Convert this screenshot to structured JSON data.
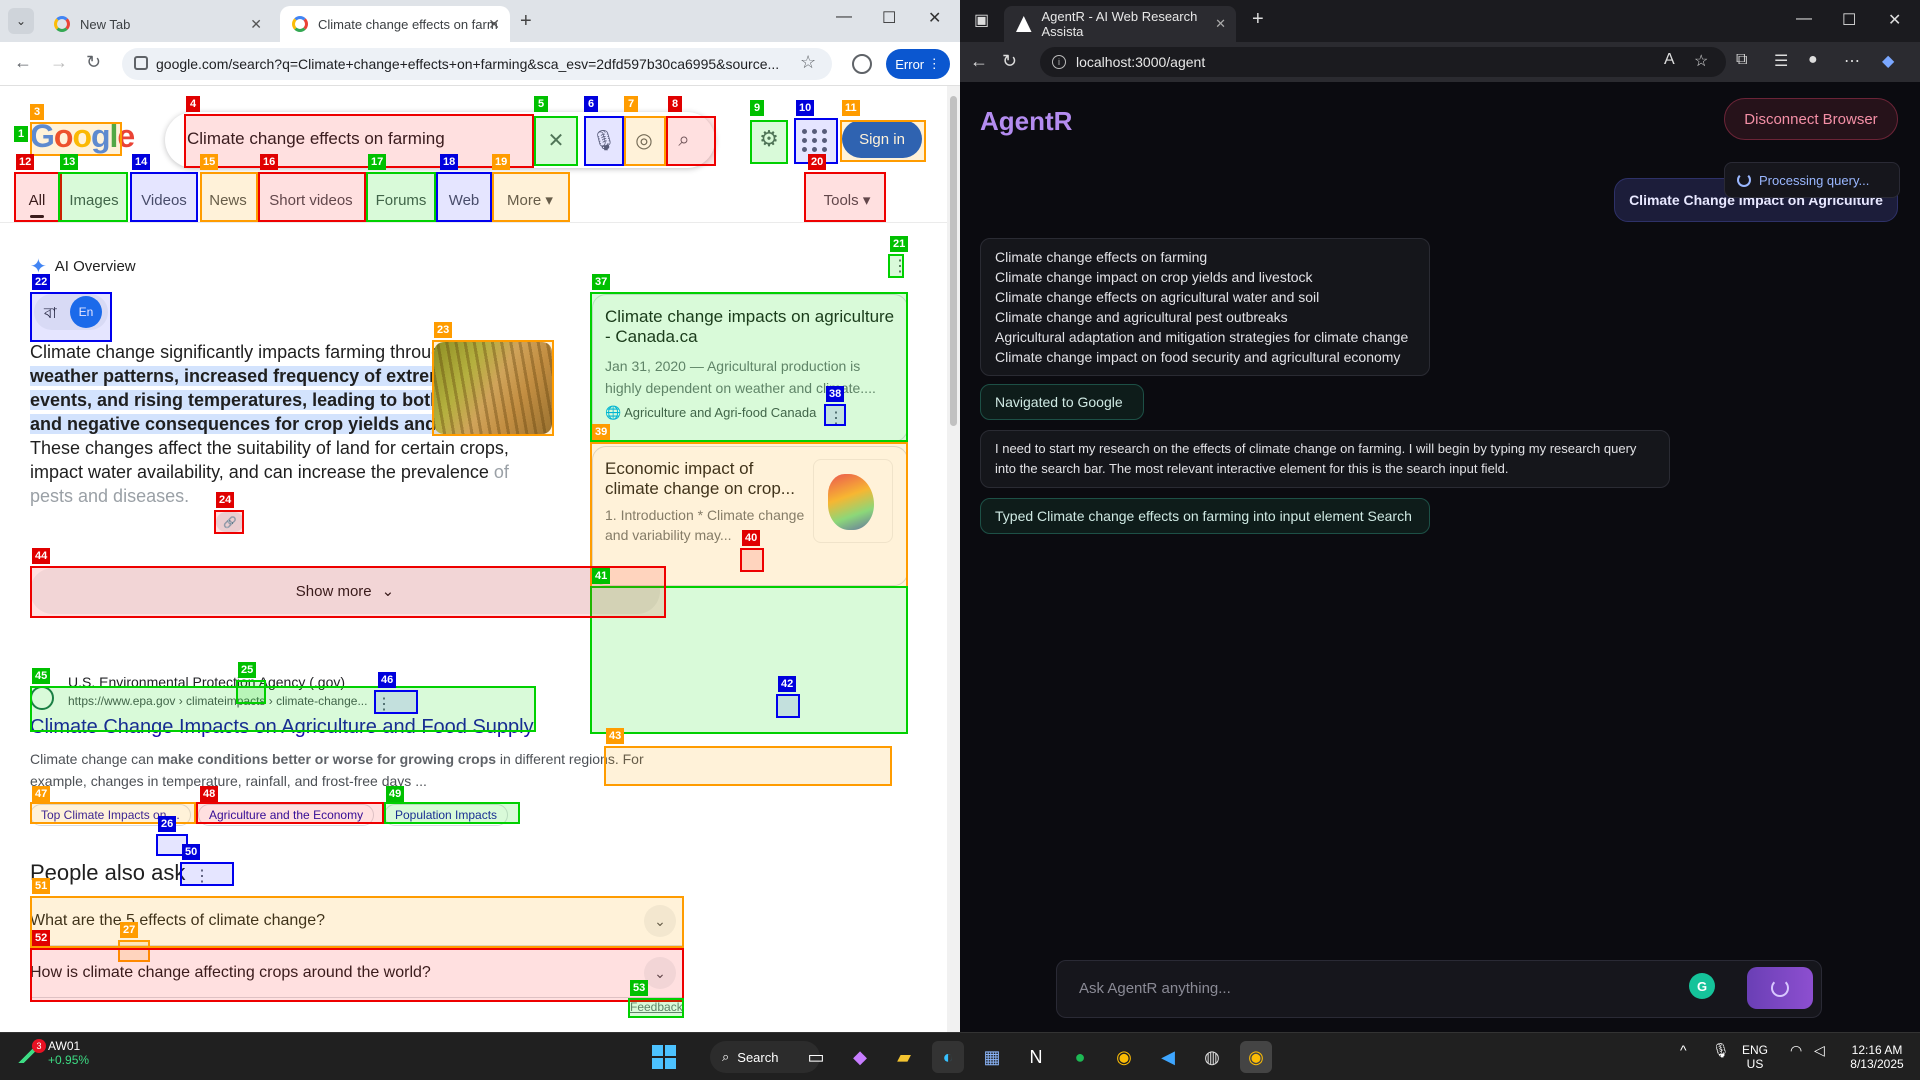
{
  "left_browser": {
    "tabs": [
      {
        "title": "New Tab"
      },
      {
        "title": "Climate change effects on farm"
      }
    ],
    "url": "google.com/search?q=Climate+change+effects+on+farming&sca_esv=2dfd597b30ca6995&source...",
    "error_label": "Error"
  },
  "google": {
    "logo": {
      "G": "G",
      "o1": "o",
      "o2": "o",
      "g": "g",
      "l": "l",
      "e": "e"
    },
    "query": "Climate change effects on farming",
    "sign_in": "Sign in",
    "tabs": [
      "All",
      "Images",
      "Videos",
      "News",
      "Short videos",
      "Forums",
      "Web",
      "More"
    ],
    "tools": "Tools",
    "ai_overview": {
      "heading": "AI Overview",
      "lang_bn": "বা",
      "lang_en": "En",
      "text_intro": "Climate change significantly impacts farming through ",
      "text_highlight": "altered weather patterns, increased frequency of extreme weather events, and rising temperatures, leading to both positive and negative consequences for crop yields and livestock",
      "text_rest": ". These changes affect the suitability of land for certain crops, impact water availability, and can increase the prevalence ",
      "text_fade": "of pests and diseases.",
      "show_more": "Show more"
    },
    "source_cards": [
      {
        "title": "Climate change impacts on agriculture - Canada.ca",
        "desc": "Jan 31, 2020 — Agricultural production is highly dependent on weather and climate....",
        "source": "Agriculture and Agri-food Canada"
      },
      {
        "title": "Economic impact of climate change on crop...",
        "desc": "1. Introduction * Climate change and variability may..."
      }
    ],
    "result": {
      "site": "U.S. Environmental Protection Agency (.gov)",
      "url": "https://www.epa.gov › climateimpacts › climate-change...",
      "title": "Climate Change Impacts on Agriculture and Food Supply",
      "snippet_a": "Climate change can ",
      "snippet_b": "make conditions better or worse for growing crops",
      "snippet_c": " in different regions. For example, changes in temperature, rainfall, and frost-free days ...",
      "sitelinks": [
        "Top Climate Impacts on ...",
        "Agriculture and the Economy",
        "Population Impacts"
      ]
    },
    "people_also_ask": {
      "heading": "People also ask",
      "questions": [
        "What are the 5 effects of climate change?",
        "How is climate change affecting crops around the world?"
      ]
    },
    "feedback": "Feedback"
  },
  "overlay_tags": [
    "1",
    "3",
    "4",
    "5",
    "6",
    "7",
    "8",
    "9",
    "10",
    "11",
    "12",
    "13",
    "14",
    "15",
    "16",
    "17",
    "18",
    "19",
    "20",
    "21",
    "22",
    "23",
    "24",
    "25",
    "26",
    "27",
    "37",
    "38",
    "39",
    "40",
    "41",
    "42",
    "43",
    "44",
    "45",
    "46",
    "47",
    "48",
    "49",
    "50",
    "51",
    "52",
    "53"
  ],
  "right_browser": {
    "tab_title": "AgentR - AI Web Research Assista",
    "url": "localhost:3000/agent"
  },
  "agent": {
    "brand": "AgentR",
    "disconnect": "Disconnect Browser",
    "processing": "Processing query...",
    "user_message": "Climate Change Impact on Agriculture",
    "queries": [
      "Climate change effects on farming",
      "Climate change impact on crop yields and livestock",
      "Climate change effects on agricultural water and soil",
      "Climate change and agricultural pest outbreaks",
      "Agricultural adaptation and mitigation strategies for climate change",
      "Climate change impact on food security and agricultural economy"
    ],
    "status_1": "Navigated to Google",
    "reasoning": "I need to start my research on the effects of climate change on farming. I will begin by typing my research query into the search bar. The most relevant interactive element for this is the search input field.",
    "status_2": "Typed Climate change effects on farming into input element Search",
    "input_placeholder": "Ask AgentR anything..."
  },
  "taskbar": {
    "stock_name": "AW01",
    "stock_change": "+0.95%",
    "stock_badge": "3",
    "search_label": "Search",
    "lang_1": "ENG",
    "lang_2": "US",
    "time": "12:16 AM",
    "date": "8/13/2025"
  }
}
